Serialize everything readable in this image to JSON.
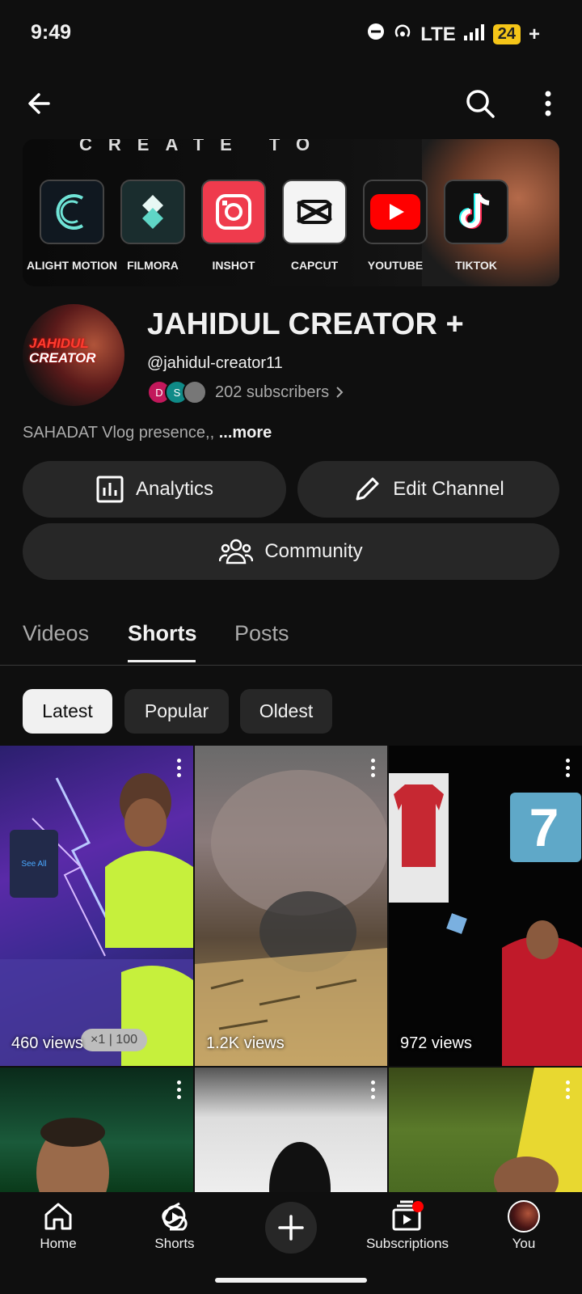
{
  "status": {
    "time": "9:49",
    "network": "LTE",
    "battery": "24"
  },
  "banner": {
    "header": "CREATE TO",
    "apps": [
      {
        "label": "ALIGHT MOTION",
        "icon": "alight-motion-icon"
      },
      {
        "label": "FILMORA",
        "icon": "filmora-icon"
      },
      {
        "label": "INSHOT",
        "icon": "inshot-icon"
      },
      {
        "label": "CAPCUT",
        "icon": "capcut-icon"
      },
      {
        "label": "YOUTUBE",
        "icon": "youtube-icon"
      },
      {
        "label": "TIKTOK",
        "icon": "tiktok-icon"
      }
    ]
  },
  "channel": {
    "avatar_text_1": "JAHIDUL",
    "avatar_text_2": "CREATOR",
    "name": "JAHIDUL CREATOR +",
    "handle": "@jahidul-creator11",
    "subscribers": "202 subscribers",
    "sub_avatars": [
      "D",
      "S",
      ""
    ],
    "description": "SAHADAT Vlog presence,,",
    "more": "...more"
  },
  "actions": {
    "analytics": "Analytics",
    "edit": "Edit Channel",
    "community": "Community"
  },
  "tabs": [
    {
      "label": "Videos",
      "active": false
    },
    {
      "label": "Shorts",
      "active": true
    },
    {
      "label": "Posts",
      "active": false
    }
  ],
  "chips": [
    {
      "label": "Latest",
      "active": true
    },
    {
      "label": "Popular",
      "active": false
    },
    {
      "label": "Oldest",
      "active": false
    }
  ],
  "shorts": [
    {
      "views": "460 views",
      "overlay_text": "See All",
      "badge": "×1 | 100"
    },
    {
      "views": "1.2K views"
    },
    {
      "views": "972 views",
      "overlay_text": "7"
    },
    {
      "views": ""
    },
    {
      "views": ""
    },
    {
      "views": ""
    }
  ],
  "nav": {
    "home": "Home",
    "shorts": "Shorts",
    "subscriptions": "Subscriptions",
    "you": "You"
  },
  "colors": {
    "background": "#0f0f0f",
    "surface": "#272727",
    "youtube_red": "#ff0000"
  }
}
